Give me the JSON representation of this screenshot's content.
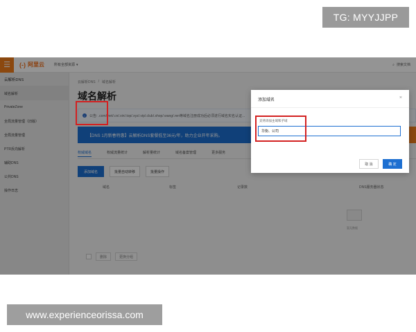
{
  "watermarks": {
    "top": "TG: MYYJJPP",
    "bottom": "www.experienceorissa.com"
  },
  "topbar": {
    "menu_icon": "hamburger-icon",
    "logo_mark": "(-)",
    "logo_text": "阿里云",
    "resource_label": "所有全部资源",
    "search_label": "搜索文档"
  },
  "sidebar": {
    "header": "云解析DNS",
    "items": [
      {
        "label": "域名解析",
        "active": true
      },
      {
        "label": "PrivateZone",
        "active": false
      },
      {
        "label": "全局流量管理（旧版）",
        "active": false
      },
      {
        "label": "全局流量管理",
        "active": false
      },
      {
        "label": "PTR反向解析",
        "active": false
      },
      {
        "label": "辅助DNS",
        "active": false
      },
      {
        "label": "公共DNS",
        "active": false
      },
      {
        "label": "操作日志",
        "active": false
      }
    ]
  },
  "main": {
    "breadcrumbs": [
      "云解析DNS",
      "/",
      "域名解析"
    ],
    "title": "域名解析",
    "notice": "公告: .com/.net/.cn/.xin/.top/.xyz/.vip/.club/.shop/.wang/.ren等域名注册成功后必须进行域名实名认证...",
    "promo": "【DNS 1月新春特惠】云解析DNS套餐低至36元/年，助力企业开年采购。",
    "tabs": [
      "权威域名",
      "权威流量统计",
      "解析量统计",
      "域名备案管理",
      "更多服务"
    ],
    "add_button": "添加域名",
    "batch_button": "批量自动转移",
    "batch_ops_button": "批量操作",
    "columns": [
      "域名",
      "标签",
      "记录数",
      "DNS服务器状态"
    ],
    "empty_text": "暂无数据",
    "pager_buttons": [
      "删除",
      "更换分组"
    ]
  },
  "dialog": {
    "title": "添加域名",
    "close_icon": "close-icon",
    "field_label": "支持添加主域和子域",
    "field_value": "华衡、公司",
    "cancel_label": "取 消",
    "ok_label": "确 定"
  }
}
